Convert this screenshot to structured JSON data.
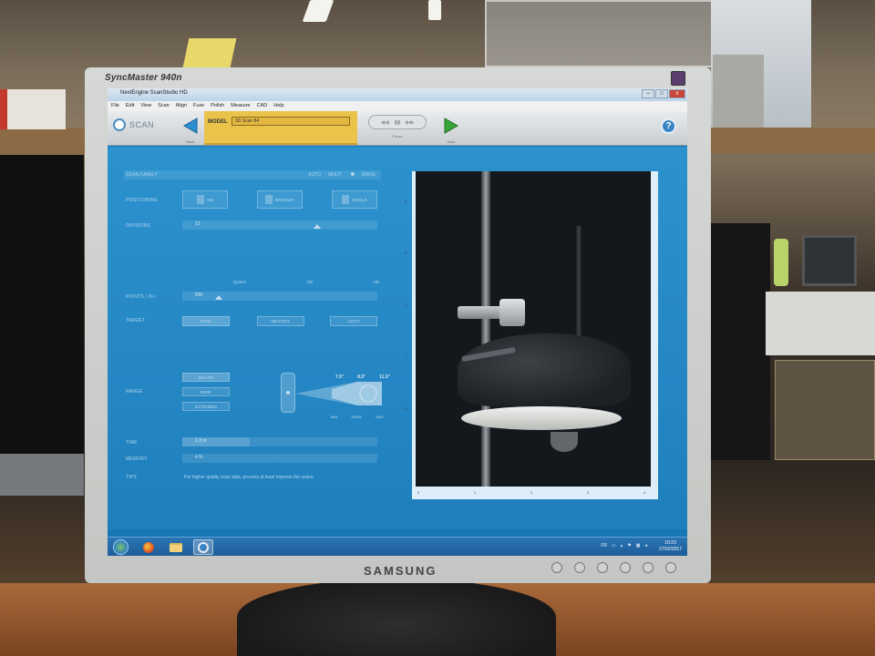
{
  "monitor": {
    "model_label": "SyncMaster 940n",
    "brand_label": "SAMSUNG"
  },
  "window": {
    "title": "NextEngine ScanStudio HD",
    "controls": [
      "–",
      "□",
      "x"
    ]
  },
  "menu": {
    "items": [
      "File",
      "Edit",
      "View",
      "Scan",
      "Align",
      "Fuse",
      "Polish",
      "Measure",
      "CAD",
      "Help"
    ]
  },
  "toolbar": {
    "scan_label": "SCAN",
    "back_caption": "Back",
    "model_label": "MODEL",
    "model_value": "3D Scan 84",
    "media_caption": "Pause",
    "next_caption": "Scan",
    "help_label": "?"
  },
  "scan_settings": {
    "scan_family_label": "SCAN FAMILY",
    "mode_options": [
      "AUTO",
      "MULTI",
      "DRIVE"
    ],
    "positioning_label": "POSITIONING",
    "positioning_options": [
      "360",
      "BRACKET",
      "SINGLE"
    ],
    "divisions_label": "DIVISIONS",
    "divisions_value": "12",
    "quality_options": [
      "QUICK",
      "SD",
      "HD"
    ],
    "points_label": "POINTS / IN.²",
    "points_value": "850",
    "target_label": "TARGET",
    "target_options": [
      "DARK",
      "NEUTRAL",
      "LIGHT"
    ],
    "range_label": "RANGE",
    "range_options": [
      "MACRO",
      "WIDE",
      "EXTENDED"
    ],
    "range_top_values": [
      "7.5\"",
      "8.5\"",
      "11.5\""
    ],
    "range_bottom_values": [
      "MIN",
      "IDEAL",
      "MAX"
    ],
    "time_label": "TIME",
    "time_value": "1.3 m",
    "memory_label": "MEMORY",
    "memory_value": "4 %",
    "tips_label": "TIPS",
    "tips_text": "For higher quality scan data, process at least improve the scans"
  },
  "camera_view": {
    "left_ticks": [
      "4",
      "3",
      "2",
      "1",
      "0"
    ],
    "bottom_ticks": [
      "0",
      "1",
      "2",
      "3",
      "4"
    ]
  },
  "taskbar": {
    "tray_lang": "FR",
    "time": "10:23",
    "date": "27/02/2017"
  },
  "colors": {
    "app_blue": "#1f7fbd",
    "model_yellow": "#e9c34a",
    "taskbar_blue": "#1d5d98",
    "next_green": "#3aa63a",
    "back_blue": "#2b8fd0"
  }
}
